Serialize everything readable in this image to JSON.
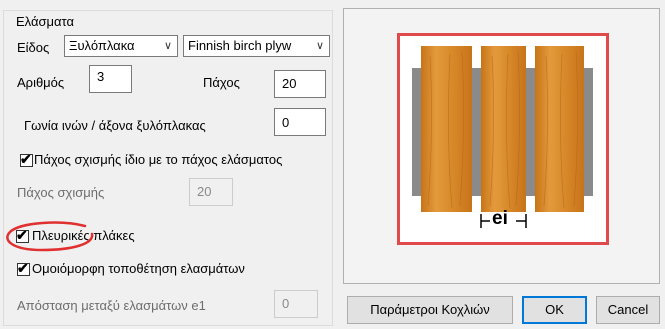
{
  "group_title": "Ελάσματα",
  "type_label": "Είδος",
  "type_value": "Ξυλόπλακα",
  "material_value": "Finnish birch plyw",
  "count_label": "Αριθμός",
  "count_value": "3",
  "thickness_label": "Πάχος",
  "thickness_value": "20",
  "angle_label": "Γωνία ινών / άξονα ξυλόπλακας",
  "angle_value": "0",
  "same_thickness_label": "Πάχος σχισμής ίδιο με το πάχος ελάσματος",
  "same_thickness_checked": true,
  "slot_thickness_label": "Πάχος σχισμής",
  "slot_thickness_value": "20",
  "side_plates_label": "Πλευρικές πλάκες",
  "side_plates_checked": true,
  "uniform_label": "Ομοιόμορφη τοποθέτηση ελασμάτων",
  "uniform_checked": true,
  "spacing_label": "Απόσταση μεταξύ ελασμάτων e1",
  "spacing_value": "0",
  "preview_dim_label": "ei",
  "buttons": {
    "bolt_params": "Παράμετροι Κοχλιών",
    "ok": "OK",
    "cancel": "Cancel"
  },
  "colors": {
    "highlight_red": "#e03030",
    "wood": "#d98a2a",
    "steel": "#8a8a8a"
  }
}
